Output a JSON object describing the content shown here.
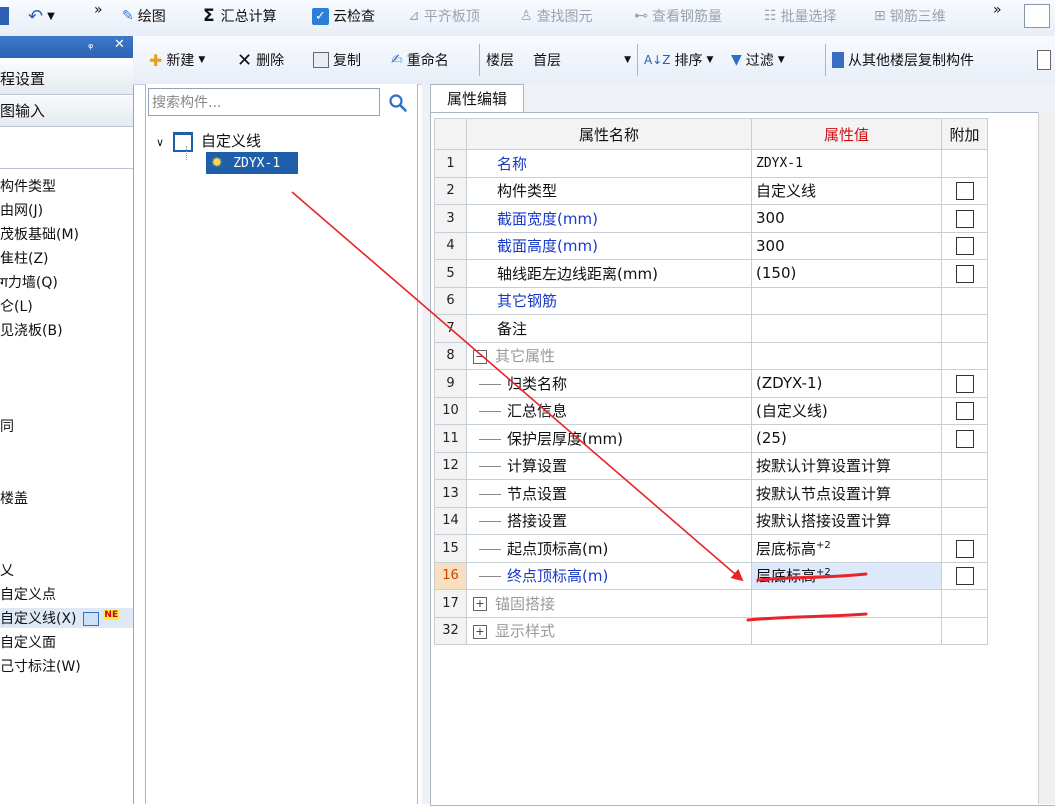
{
  "toolbar": {
    "more_left": "»",
    "draw": "绘图",
    "summary": "汇总计算",
    "cloud_check": "云检查",
    "flat_top": "平齐板顶",
    "find_element": "查找图元",
    "view_rebar": "查看钢筋量",
    "batch_select": "批量选择",
    "rebar_3d": "钢筋三维",
    "more_right": "»"
  },
  "left_panel": {
    "pin": "ᵩ",
    "close": "✕",
    "tab1": "程设置",
    "tab2": "图输入",
    "items": [
      "构件类型",
      "由网(J)",
      "茂板基础(M)",
      "隹柱(Z)",
      "ग力墙(Q)",
      "仑(L)",
      "见浇板(B)",
      "同",
      "楼盖",
      "乂",
      "自定义点",
      "自定义线(X)",
      "自定义面",
      "己寸标注(W)"
    ],
    "badge": "NE"
  },
  "toolbar2": {
    "new": "新建",
    "delete": "删除",
    "copy": "复制",
    "rename": "重命名",
    "floor_label": "楼层",
    "floor_value": "首层",
    "sort": "排序",
    "filter": "过滤",
    "copy_from_floor": "从其他楼层复制构件"
  },
  "component_tree": {
    "search_placeholder": "搜索构件...",
    "root": "自定义线",
    "child": "ZDYX-1"
  },
  "property_editor": {
    "tab": "属性编辑",
    "headers": {
      "name": "属性名称",
      "value": "属性值",
      "extra": "附加"
    },
    "rows": [
      {
        "num": "1",
        "name": "名称",
        "value": "ZDYX-1"
      },
      {
        "num": "2",
        "name": "构件类型",
        "value": "自定义线"
      },
      {
        "num": "3",
        "name": "截面宽度(mm)",
        "value": "300"
      },
      {
        "num": "4",
        "name": "截面高度(mm)",
        "value": "300"
      },
      {
        "num": "5",
        "name": "轴线距左边线距离(mm)",
        "value": "(150)"
      },
      {
        "num": "6",
        "name": "其它钢筋",
        "value": ""
      },
      {
        "num": "7",
        "name": "备注",
        "value": ""
      },
      {
        "num": "8",
        "name": "其它属性",
        "value": ""
      },
      {
        "num": "9",
        "name": "归类名称",
        "value": "(ZDYX-1)"
      },
      {
        "num": "10",
        "name": "汇总信息",
        "value": "(自定义线)"
      },
      {
        "num": "11",
        "name": "保护层厚度(mm)",
        "value": "(25)"
      },
      {
        "num": "12",
        "name": "计算设置",
        "value": "按默认计算设置计算"
      },
      {
        "num": "13",
        "name": "节点设置",
        "value": "按默认节点设置计算"
      },
      {
        "num": "14",
        "name": "搭接设置",
        "value": "按默认搭接设置计算"
      },
      {
        "num": "15",
        "name": "起点顶标高(m)",
        "value": "层底标高",
        "value_sup": "+2"
      },
      {
        "num": "16",
        "name": "终点顶标高(m)",
        "value": "层底标高",
        "value_sup": "+2"
      },
      {
        "num": "17",
        "name": "锚固搭接",
        "value": ""
      },
      {
        "num": "32",
        "name": "显示样式",
        "value": ""
      }
    ]
  },
  "colors": {
    "accent_blue": "#1a39c8",
    "header_orange": "#f6c26f",
    "annotation_red": "#e8242a",
    "selection_blue": "#dde9fb"
  }
}
